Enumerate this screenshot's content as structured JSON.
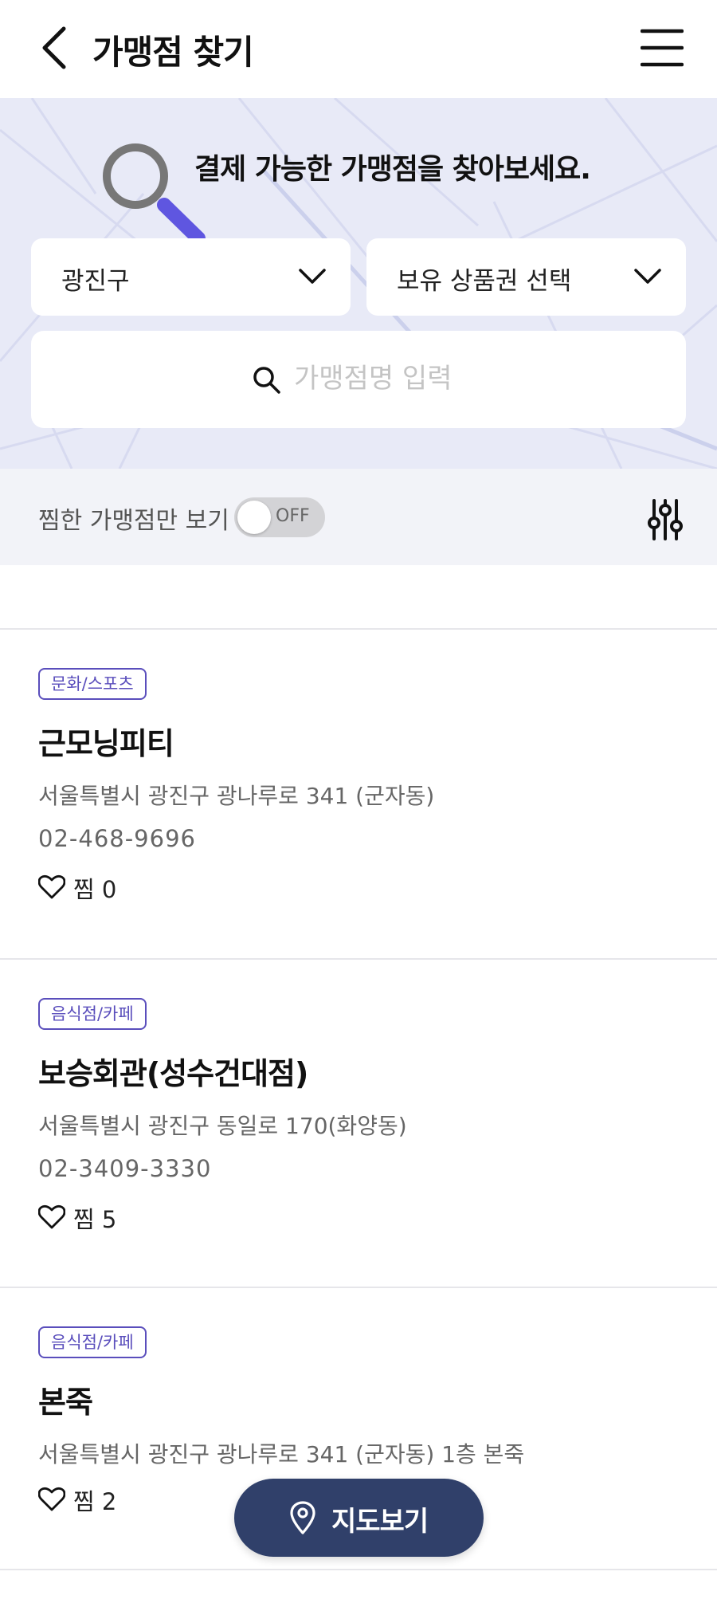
{
  "header": {
    "title": "가맹점 찾기",
    "back_icon": "back-arrow-icon",
    "menu_icon": "hamburger-menu-icon"
  },
  "hero": {
    "message": "결제 가능한 가맹점을 찾아보세요.",
    "district_select": {
      "value": "광진구"
    },
    "voucher_select": {
      "value": "보유 상품권 선택"
    },
    "search": {
      "placeholder": "가맹점명 입력",
      "value": ""
    }
  },
  "filter": {
    "favorites_only_label": "찜한 가맹점만 보기",
    "toggle_state": "OFF"
  },
  "stores": [
    {
      "category": "문화/스포츠",
      "name": "근모닝피티",
      "address": "서울특별시 광진구 광나루로 341 (군자동)",
      "phone": "02-468-9696",
      "like_label": "찜 0"
    },
    {
      "category": "음식점/카페",
      "name": "보승회관(성수건대점)",
      "address": "서울특별시 광진구 동일로 170(화양동)",
      "phone": "02-3409-3330",
      "like_label": "찜 5"
    },
    {
      "category": "음식점/카페",
      "name": "본죽",
      "address": "서울특별시 광진구 광나루로 341 (군자동) 1층 본죽",
      "phone": "",
      "like_label": "찜 2"
    }
  ],
  "map_button": {
    "label": "지도보기"
  },
  "colors": {
    "accent": "#5a4ebc",
    "map_button": "#30406a",
    "hero_bg": "#e8eaf7",
    "filter_bg": "#f2f3f8"
  }
}
